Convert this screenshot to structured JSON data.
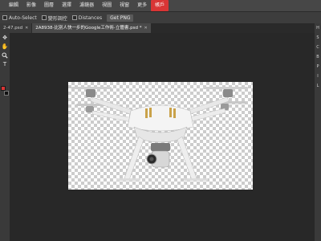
{
  "menu": {
    "items": [
      "編輯",
      "影像",
      "圖層",
      "選擇",
      "濾鏡器",
      "視圖",
      "視窗",
      "更多"
    ],
    "active": "帳戶"
  },
  "options": {
    "auto_select": "Auto-Select",
    "transform": "變形調控",
    "distances": "Distances",
    "get_png": "Get PNG"
  },
  "tabs": [
    {
      "label": "2-47.psd",
      "close": "✕"
    },
    {
      "label": "2A8938-比別人快一步的Google工作術-立體書.psd *",
      "close": "✕"
    }
  ],
  "tools": {
    "move": "✥",
    "hand": "✋",
    "zoom": "🔍",
    "type": "T"
  },
  "right_panel": [
    "H",
    "S",
    "C",
    "B",
    "P",
    "I",
    "L"
  ],
  "colors": {
    "foreground": "#d93535",
    "background": "#111111",
    "accent": "#d93535"
  }
}
